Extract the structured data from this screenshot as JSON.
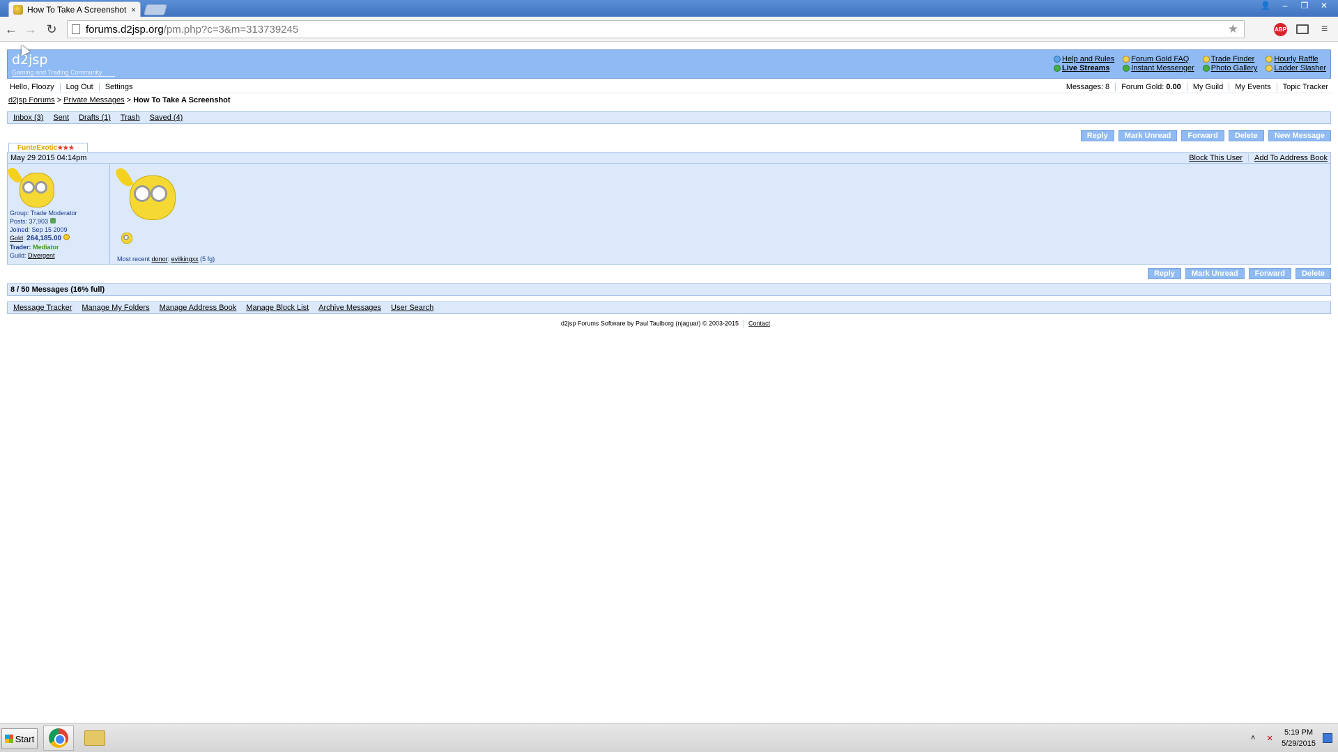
{
  "browser": {
    "tab_title": "How To Take A Screenshot f",
    "tab_close": "×",
    "url_host": "forums.d2jsp.org",
    "url_path": "/pm.php?c=3&m=313739245",
    "back": "←",
    "forward": "→",
    "reload": "↻",
    "star": "★",
    "abp": "ABP",
    "menu": "≡",
    "window_buttons": [
      "👤",
      "–",
      "❐",
      "✕"
    ]
  },
  "header": {
    "logo": "d2jsp",
    "tagline": "Gaming and Trading Community",
    "links": [
      {
        "label": "Help and Rules",
        "icon": "help-icon"
      },
      {
        "label": "Forum Gold FAQ",
        "icon": "gold-faq-icon"
      },
      {
        "label": "Trade Finder",
        "icon": "trade-finder-icon"
      },
      {
        "label": "Hourly Raffle",
        "icon": "raffle-icon"
      },
      {
        "label": "Live Streams",
        "icon": "live-streams-icon"
      },
      {
        "label": "Instant Messenger",
        "icon": "messenger-icon"
      },
      {
        "label": "Photo Gallery",
        "icon": "photo-gallery-icon"
      },
      {
        "label": "Ladder Slasher",
        "icon": "ladder-slasher-icon"
      }
    ]
  },
  "user_bar": {
    "hello": "Hello, Floozy",
    "log_out": "Log Out",
    "settings": "Settings",
    "messages": "Messages: 8",
    "forum_gold_label": "Forum Gold:",
    "forum_gold_value": "0.00",
    "my_guild": "My Guild",
    "my_events": "My Events",
    "topic_tracker": "Topic Tracker"
  },
  "breadcrumb": {
    "forums": "d2jsp Forums",
    "sep1": ">",
    "private_messages": "Private Messages",
    "sep2": ">",
    "current": "How To Take A Screenshot"
  },
  "folders": [
    "Inbox (3)",
    "Sent",
    "Drafts (1)",
    "Trash",
    "Saved (4)"
  ],
  "actions_top": [
    "Reply",
    "Mark Unread",
    "Forward",
    "Delete",
    "New Message"
  ],
  "actions_bottom": [
    "Reply",
    "Mark Unread",
    "Forward",
    "Delete"
  ],
  "message": {
    "author": "FunteExotic",
    "author_stars": "★★★",
    "date": "May 29 2015 04:14pm",
    "block_user": "Block This User",
    "add_address_book": "Add To Address Book",
    "profile": {
      "group": "Group: Trade Moderator",
      "posts": "Posts: 37,903",
      "joined": "Joined: Sep 15 2009",
      "gold_label": "Gold",
      "gold_value": "264,185.00",
      "trader_label": "Trader:",
      "trader_value": "Mediator",
      "guild_label": "Guild:",
      "guild_value": "Divergent"
    },
    "donor_prefix": "Most recent",
    "donor_link": "donor",
    "donor_sep": ":",
    "donor_name": "evilkingxx",
    "donor_amount": "(5 fg)"
  },
  "status": "8 / 50 Messages (16% full)",
  "tools": [
    "Message Tracker",
    "Manage My Folders",
    "Manage Address Book",
    "Manage Block List",
    "Archive Messages",
    "User Search"
  ],
  "footer": {
    "credit": "d2jsp Forums Software by Paul Taulborg (njaguar) © 2003-2015",
    "contact": "Contact"
  },
  "taskbar": {
    "start": "Start",
    "time": "5:19 PM",
    "date": "5/29/2015",
    "tray_up": "˄"
  }
}
